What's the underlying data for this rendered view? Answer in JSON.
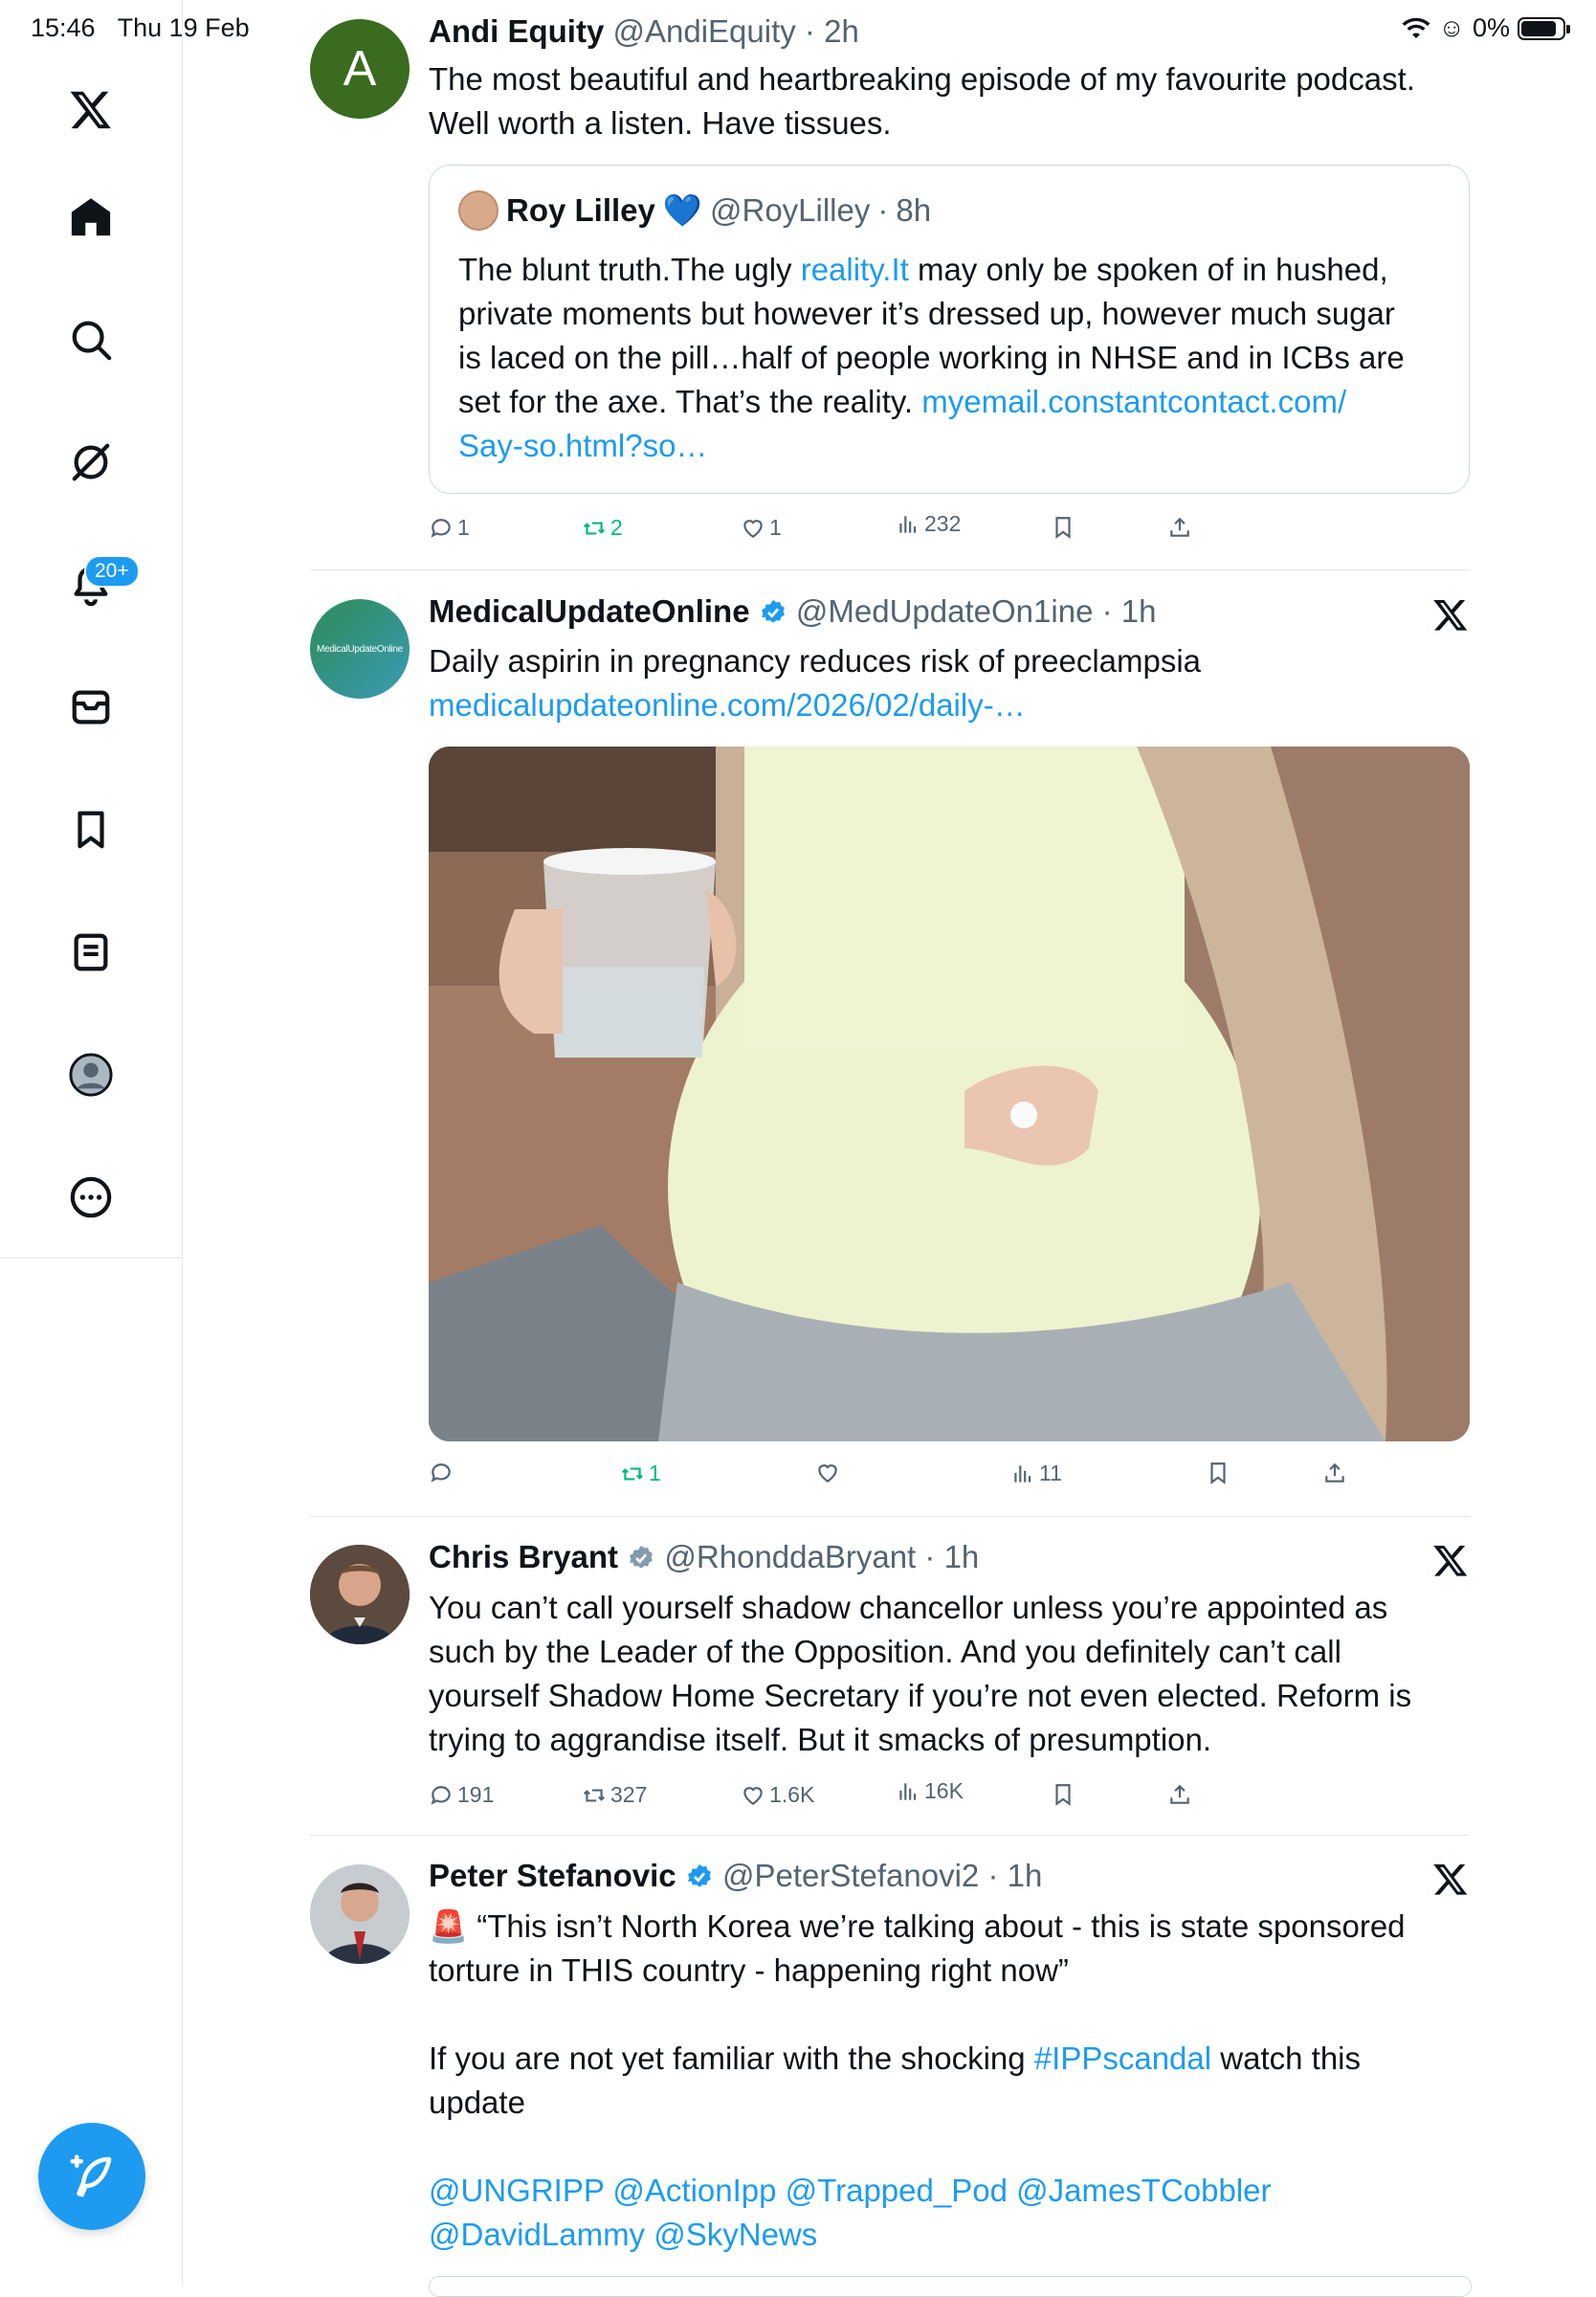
{
  "status": {
    "time": "15:46",
    "date": "Thu 19 Feb",
    "battery": "0%",
    "battery_level": 0.85
  },
  "sidebar": {
    "items": [
      {
        "name": "x-logo"
      },
      {
        "name": "home"
      },
      {
        "name": "explore"
      },
      {
        "name": "grok"
      },
      {
        "name": "notifications"
      },
      {
        "name": "messages"
      },
      {
        "name": "bookmarks"
      },
      {
        "name": "lists"
      },
      {
        "name": "profile"
      },
      {
        "name": "more"
      }
    ],
    "notifications_badge": "20+"
  },
  "tweets": [
    {
      "avatar_letter": "A",
      "name": "Andi Equity",
      "handle": "@AndiEquity",
      "time": "2h",
      "text_lines": [
        "The most beautiful and heartbreaking episode of my favourite podcast.",
        "Well worth a listen. Have tissues."
      ],
      "quote": {
        "name": "Roy Lilley",
        "emoji": "💙",
        "handle": "@RoyLilley",
        "time": "8h",
        "line1_pre": "The blunt truth.The ugly ",
        "line1_link": "reality.It",
        "line1_post": " may only be spoken of in hushed,",
        "line2": "private moments but however it’s dressed up, however much sugar",
        "line3": "is laced on the pill…half of people working in NHSE and in ICBs are",
        "line4_pre": "set for the axe. That’s the reality. ",
        "line4_link": "myemail.constantcontact.com/",
        "line5_link": "Say-so.html?so…"
      },
      "actions": {
        "replies": "1",
        "reposts": "2",
        "likes": "1",
        "views": "232"
      }
    },
    {
      "avatar_text": "MedicalUpdateOnline",
      "name": "MedicalUpdateOnline",
      "handle": "@MedUpdateOn1ine",
      "time": "1h",
      "text": "Daily aspirin in pregnancy reduces risk of preeclampsia",
      "link": "medicalupdateonline.com/2026/02/daily-…",
      "actions": {
        "replies": "",
        "reposts": "1",
        "likes": "",
        "views": "11"
      }
    },
    {
      "name": "Chris Bryant",
      "handle": "@RhonddaBryant",
      "time": "1h",
      "text_lines": [
        "You can’t call yourself shadow chancellor unless you’re appointed as",
        "such by the Leader of the Opposition. And you definitely can’t call",
        "yourself Shadow Home Secretary if you’re not even elected. Reform is",
        "trying to aggrandise itself. But it smacks of presumption."
      ],
      "actions": {
        "replies": "191",
        "reposts": "327",
        "likes": "1.6K",
        "views": "16K"
      }
    },
    {
      "name": "Peter Stefanovic",
      "handle": "@PeterStefanovi2",
      "time": "1h",
      "emoji": "🚨",
      "line1": " “This isn’t North Korea we’re talking about  - this is state sponsored",
      "line2": "torture in THIS country - happening right now”",
      "line3_pre": "If you are not yet familiar with the shocking ",
      "line3_link": "#IPPscandal",
      "line3_post": " watch this",
      "line4": "update",
      "mentions_line1": "@UNGRIPP @ActionIpp @Trapped_Pod @JamesTCobbler",
      "mentions_line2": "@DavidLammy @SkyNews"
    }
  ],
  "colors": {
    "accent": "#1d9bf0",
    "repost_green": "#00ba7c",
    "muted": "#536471"
  }
}
